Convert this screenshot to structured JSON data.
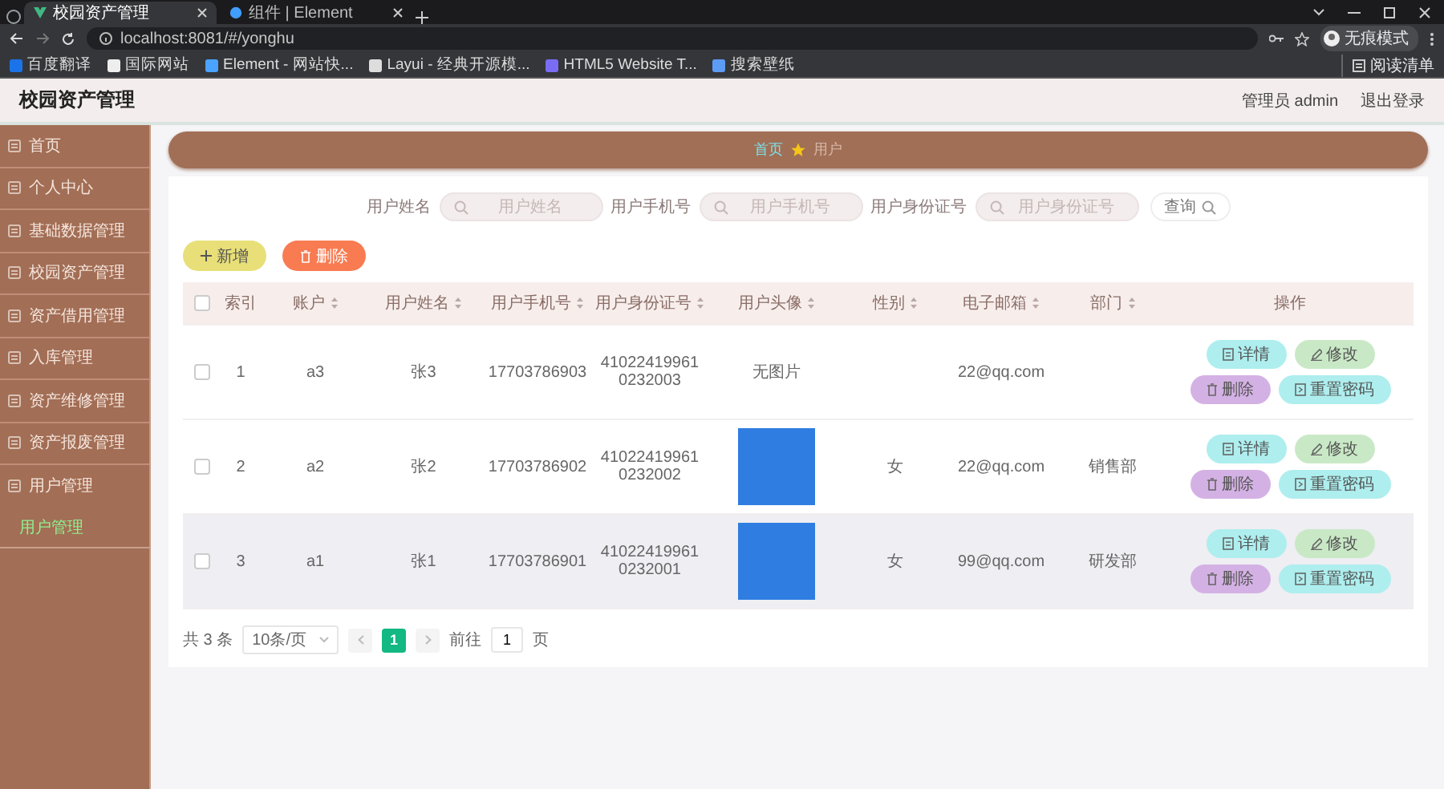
{
  "browser": {
    "tabs": [
      {
        "title": "校园资产管理",
        "selected": true
      },
      {
        "title": "组件 | Element",
        "selected": false
      }
    ],
    "url": "localhost:8081/#/yonghu",
    "profile": "无痕模式",
    "bookmarks": [
      "百度翻译",
      "国际网站",
      "Element - 网站快...",
      "Layui - 经典开源模...",
      "HTML5 Website T...",
      "搜索壁纸"
    ],
    "reading_list": "阅读清单"
  },
  "header": {
    "title": "校园资产管理",
    "user": "管理员 admin",
    "logout": "退出登录"
  },
  "sidebar": {
    "items": [
      {
        "label": "首页",
        "expanded": false
      },
      {
        "label": "个人中心",
        "expanded": false
      },
      {
        "label": "基础数据管理",
        "expanded": false
      },
      {
        "label": "校园资产管理",
        "expanded": false
      },
      {
        "label": "资产借用管理",
        "expanded": false
      },
      {
        "label": "入库管理",
        "expanded": false
      },
      {
        "label": "资产维修管理",
        "expanded": false
      },
      {
        "label": "资产报废管理",
        "expanded": false
      },
      {
        "label": "用户管理",
        "expanded": true,
        "children": [
          {
            "label": "用户管理",
            "selected": true
          }
        ]
      }
    ]
  },
  "breadcrumb": [
    "首页",
    "用户"
  ],
  "search": {
    "fields": [
      {
        "label": "用户姓名",
        "placeholder": "用户姓名"
      },
      {
        "label": "用户手机号",
        "placeholder": "用户手机号"
      },
      {
        "label": "用户身份证号",
        "placeholder": "用户身份证号"
      }
    ],
    "button": "查询"
  },
  "toolbar": [
    {
      "label": "新增",
      "kind": "add"
    },
    {
      "label": "删除",
      "kind": "delete"
    }
  ],
  "table": {
    "header_checked": false,
    "columns": [
      {
        "label": "索引",
        "sortable": false
      },
      {
        "label": "账户",
        "sortable": true
      },
      {
        "label": "用户姓名",
        "sortable": true
      },
      {
        "label": "用户手机号",
        "sortable": true
      },
      {
        "label": "用户身份证号",
        "sortable": true
      },
      {
        "label": "用户头像",
        "sortable": true
      },
      {
        "label": "性别",
        "sortable": true
      },
      {
        "label": "电子邮箱",
        "sortable": true
      },
      {
        "label": "部门",
        "sortable": true
      },
      {
        "label": "操作",
        "sortable": false
      }
    ],
    "rows": [
      {
        "checked": false,
        "hovered": false,
        "index": "1",
        "account": "a3",
        "name": "张3",
        "phone": "17703786903",
        "id_number": "410224199610232003",
        "avatar": {
          "kind": "text",
          "text": "无图片"
        },
        "email": "22@qq.com",
        "actions": [
          {
            "label": "详情",
            "kind": "detail"
          },
          {
            "label": "修改",
            "kind": "edit"
          },
          {
            "label": "删除",
            "kind": "delete"
          },
          {
            "label": "重置密码",
            "kind": "reset"
          }
        ]
      },
      {
        "checked": false,
        "hovered": false,
        "index": "2",
        "account": "a2",
        "name": "张2",
        "phone": "17703786902",
        "id_number": "410224199610232002",
        "avatar": {
          "kind": "photo"
        },
        "gender": "女",
        "email": "22@qq.com",
        "department": "销售部",
        "actions": [
          {
            "label": "详情",
            "kind": "detail"
          },
          {
            "label": "修改",
            "kind": "edit"
          },
          {
            "label": "删除",
            "kind": "delete"
          },
          {
            "label": "重置密码",
            "kind": "reset"
          }
        ]
      },
      {
        "checked": false,
        "hovered": true,
        "index": "3",
        "account": "a1",
        "name": "张1",
        "phone": "17703786901",
        "id_number": "410224199610232001",
        "avatar": {
          "kind": "photo"
        },
        "gender": "女",
        "email": "99@qq.com",
        "department": "研发部",
        "actions": [
          {
            "label": "详情",
            "kind": "detail"
          },
          {
            "label": "修改",
            "kind": "edit"
          },
          {
            "label": "删除",
            "kind": "delete"
          },
          {
            "label": "重置密码",
            "kind": "reset"
          }
        ]
      }
    ]
  },
  "pagination": {
    "total": "共 3 条",
    "page_size": "10条/页",
    "pages": [
      {
        "label": "1",
        "selected": true
      }
    ],
    "goto_label": "前往",
    "goto_value": "1",
    "goto_suffix": "页"
  }
}
